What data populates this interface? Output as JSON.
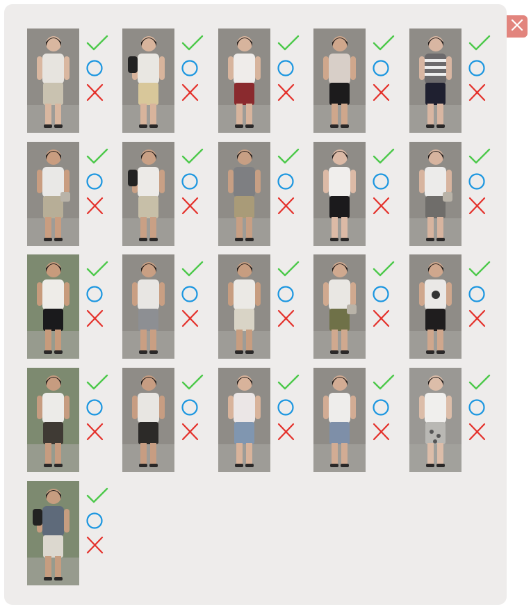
{
  "dialog": {
    "close_icon": "close-icon",
    "colors": {
      "panel_bg": "#eeeceb",
      "close_bg": "#e2847d",
      "check": "#4cc94a",
      "circle": "#1b96e0",
      "cross": "#e4302a"
    }
  },
  "rows": [
    [
      {
        "scene": "street",
        "shirt": "#e7e4df",
        "bottom": "#c9c2b0",
        "hair": "#1a1614",
        "skin": "#d9b7a0",
        "accessory": "none"
      },
      {
        "scene": "street",
        "shirt": "#e9e7e2",
        "bottom": "#d8c79a",
        "hair": "#1a1614",
        "skin": "#d8b49c",
        "accessory": "backpack"
      },
      {
        "scene": "street",
        "shirt": "#efecea",
        "bottom": "#8a2a2e",
        "hair": "#1e1918",
        "skin": "#d7b49d",
        "accessory": "none"
      },
      {
        "scene": "street",
        "shirt": "#d8cfc8",
        "bottom": "#1c1b1c",
        "hair": "#201c1b",
        "skin": "#cfa78c",
        "accessory": "none"
      },
      {
        "scene": "street",
        "shirt": "#6c6a6c",
        "bottom": "#1f2030",
        "hair": "#1d1918",
        "skin": "#d8b6a2",
        "accessory": "striped"
      }
    ],
    [
      {
        "scene": "street",
        "shirt": "#e9e8e6",
        "bottom": "#b7ae97",
        "hair": "#1b1817",
        "skin": "#c99d80",
        "accessory": "bag"
      },
      {
        "scene": "street",
        "shirt": "#eceae7",
        "bottom": "#c7bfa8",
        "hair": "#1c1918",
        "skin": "#c9a085",
        "accessory": "backpack"
      },
      {
        "scene": "street",
        "shirt": "#7e7f82",
        "bottom": "#a99b78",
        "hair": "#1b1817",
        "skin": "#c79f84",
        "accessory": "none"
      },
      {
        "scene": "street",
        "shirt": "#f0eeec",
        "bottom": "#1b1a1c",
        "hair": "#1d1918",
        "skin": "#dcbaa6",
        "accessory": "none"
      },
      {
        "scene": "street",
        "shirt": "#ecebea",
        "bottom": "#6f6d6a",
        "hair": "#1d1918",
        "skin": "#d7b49f",
        "accessory": "bag"
      }
    ],
    [
      {
        "scene": "park",
        "shirt": "#eeece8",
        "bottom": "#1a1a1c",
        "hair": "#1a1615",
        "skin": "#c79b7c",
        "accessory": "none"
      },
      {
        "scene": "street",
        "shirt": "#e8e6e3",
        "bottom": "#8d8f93",
        "hair": "#1d1918",
        "skin": "#c99f83",
        "accessory": "none"
      },
      {
        "scene": "street",
        "shirt": "#ebe9e5",
        "bottom": "#d9d4c6",
        "hair": "#1b1817",
        "skin": "#c79d80",
        "accessory": "none"
      },
      {
        "scene": "street",
        "shirt": "#e9e7e3",
        "bottom": "#6f7148",
        "hair": "#1c1918",
        "skin": "#d0a98f",
        "accessory": "bag"
      },
      {
        "scene": "street",
        "shirt": "#eae8e6",
        "bottom": "#1f1d1e",
        "hair": "#1c1918",
        "skin": "#cfa78d",
        "accessory": "print"
      }
    ],
    [
      {
        "scene": "park",
        "shirt": "#ecebe8",
        "bottom": "#3f3a34",
        "hair": "#1b1817",
        "skin": "#c69c80",
        "accessory": "none"
      },
      {
        "scene": "street",
        "shirt": "#e8e6e2",
        "bottom": "#2c2a28",
        "hair": "#1c1817",
        "skin": "#c79d82",
        "accessory": "none"
      },
      {
        "scene": "street",
        "shirt": "#ebe6e6",
        "bottom": "#8096b0",
        "hair": "#1c1817",
        "skin": "#d8b39b",
        "accessory": "none"
      },
      {
        "scene": "street",
        "shirt": "#eeedeb",
        "bottom": "#7e8fa8",
        "hair": "#1c1817",
        "skin": "#d2ac94",
        "accessory": "none"
      },
      {
        "scene": "wall",
        "shirt": "#f0efed",
        "bottom": "#b9b8b4",
        "hair": "#1c1817",
        "skin": "#dcbda9",
        "accessory": "floral"
      }
    ],
    [
      {
        "scene": "park",
        "shirt": "#5e6a7a",
        "bottom": "#dcd8cf",
        "hair": "#1b1817",
        "skin": "#c69d80",
        "accessory": "backpack"
      }
    ]
  ],
  "marks": {
    "check_icon": "check-icon",
    "circle_icon": "circle-icon",
    "cross_icon": "cross-icon"
  }
}
